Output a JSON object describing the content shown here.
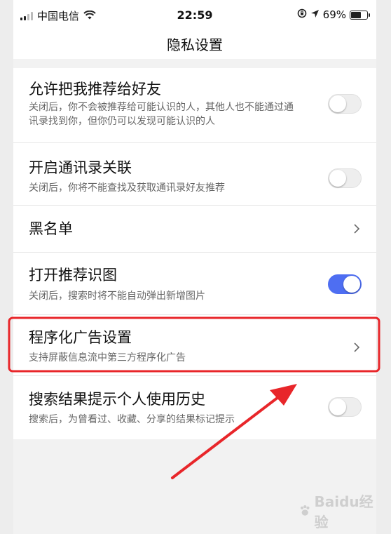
{
  "status_bar": {
    "carrier": "中国电信",
    "time": "22:59",
    "battery": "69%",
    "battery_level": 0.69
  },
  "nav": {
    "title": "隐私设置"
  },
  "settings": [
    {
      "title": "允许把我推荐给好友",
      "subtitle": "关闭后，你不会被推荐给可能认识的人，其他人也不能通过通讯录找到你，但你仍可以发现可能认识的人",
      "control": "toggle",
      "on": false
    },
    {
      "title": "开启通讯录关联",
      "subtitle": "关闭后，你将不能查找及获取通讯录好友推荐",
      "control": "toggle",
      "on": false
    },
    {
      "title": "黑名单",
      "control": "chevron"
    },
    {
      "title": "打开推荐识图",
      "subtitle": "关闭后，搜索时将不能自动弹出新增图片",
      "control": "toggle",
      "on": true
    },
    {
      "title": "程序化广告设置",
      "subtitle": "支持屏蔽信息流中第三方程序化广告",
      "control": "chevron"
    },
    {
      "title": "搜索结果提示个人使用历史",
      "subtitle": "搜索后，为曾看过、收藏、分享的结果标记提示",
      "control": "toggle",
      "on": false
    }
  ],
  "colors": {
    "toggle_on": "#4e6ef2",
    "annotation": "#e8262a"
  },
  "watermark": "Baidu经验"
}
